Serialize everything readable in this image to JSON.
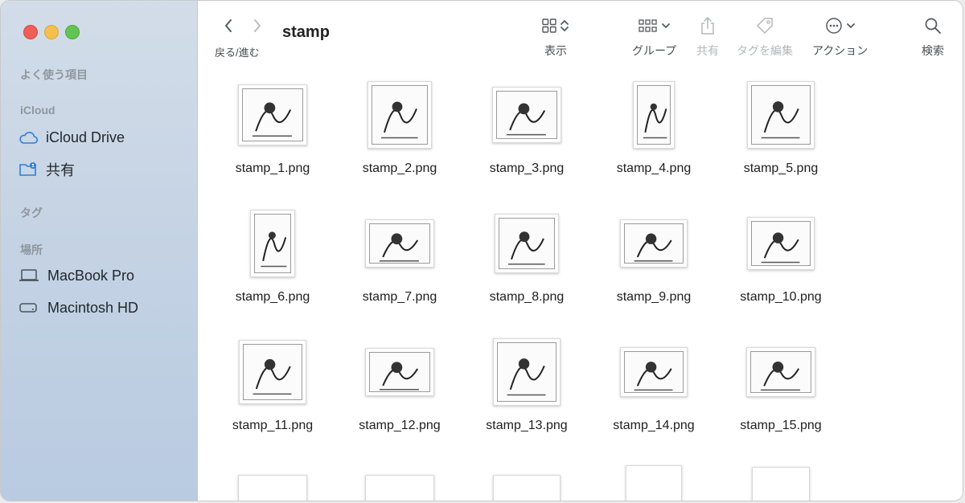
{
  "window": {
    "folder_title": "stamp"
  },
  "sidebar": {
    "sections": [
      {
        "label": "よく使う項目"
      },
      {
        "label": "iCloud"
      },
      {
        "label": "タグ"
      },
      {
        "label": "場所"
      }
    ],
    "items": [
      {
        "label": "iCloud Drive",
        "icon": "cloud-icon"
      },
      {
        "label": "共有",
        "icon": "shared-folder-icon"
      },
      {
        "label": "MacBook Pro",
        "icon": "laptop-icon"
      },
      {
        "label": "Macintosh HD",
        "icon": "disk-icon"
      }
    ]
  },
  "toolbar": {
    "back_forward_label": "戻る/進む",
    "view_label": "表示",
    "group_label": "グループ",
    "share_label": "共有",
    "tags_label": "タグを編集",
    "action_label": "アクション",
    "search_label": "検索"
  },
  "files": [
    {
      "name": "stamp_1.png"
    },
    {
      "name": "stamp_2.png"
    },
    {
      "name": "stamp_3.png"
    },
    {
      "name": "stamp_4.png"
    },
    {
      "name": "stamp_5.png"
    },
    {
      "name": "stamp_6.png"
    },
    {
      "name": "stamp_7.png"
    },
    {
      "name": "stamp_8.png"
    },
    {
      "name": "stamp_9.png"
    },
    {
      "name": "stamp_10.png"
    },
    {
      "name": "stamp_11.png"
    },
    {
      "name": "stamp_12.png"
    },
    {
      "name": "stamp_13.png"
    },
    {
      "name": "stamp_14.png"
    },
    {
      "name": "stamp_15.png"
    }
  ]
}
